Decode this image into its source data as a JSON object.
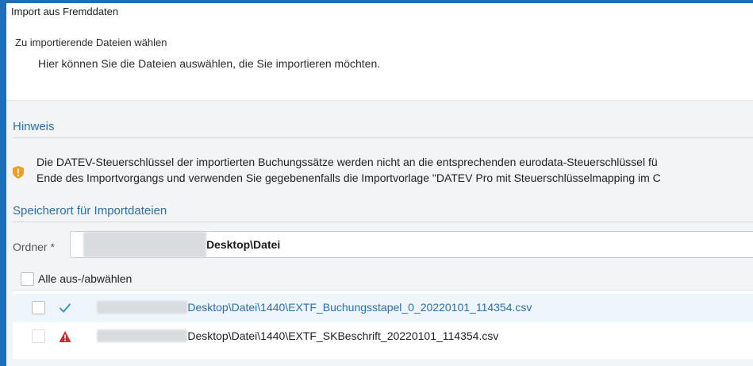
{
  "window": {
    "title": "Import aus Fremddaten"
  },
  "header": {
    "step_title": "Zu importierende Dateien wählen",
    "step_description": "Hier können Sie die Dateien auswählen, die Sie importieren möchten."
  },
  "hint_section": {
    "title": "Hinweis",
    "icon": "shield-warning-icon",
    "line1": "Die DATEV-Steuerschlüssel der importierten Buchungssätze werden nicht an die entsprechenden eurodata-Steuerschlüssel fü",
    "line2": "Ende des Importvorgangs und verwenden Sie gegebenenfalls die Importvorlage \"DATEV Pro mit Steuerschlüsselmapping im C"
  },
  "storage_section": {
    "title": "Speicherort für Importdateien",
    "folder_label": "Ordner *",
    "folder_value": "Desktop\\Datei"
  },
  "select_all_label": "Alle aus-/abwählen",
  "files": [
    {
      "path": "Desktop\\Datei\\1440\\EXTF_Buchungsstapel_0_20220101_114354.csv",
      "status": "ok",
      "status_icon": "checkmark-icon"
    },
    {
      "path": "Desktop\\Datei\\1440\\EXTF_SKBeschrift_20220101_114354.csv",
      "status": "error",
      "status_icon": "warning-triangle-icon"
    }
  ],
  "colors": {
    "frame": "#1e6fb5",
    "section_title": "#2a6eb0",
    "check": "#2a8fbf",
    "error": "#d8262e",
    "shield": "#f0a020"
  }
}
